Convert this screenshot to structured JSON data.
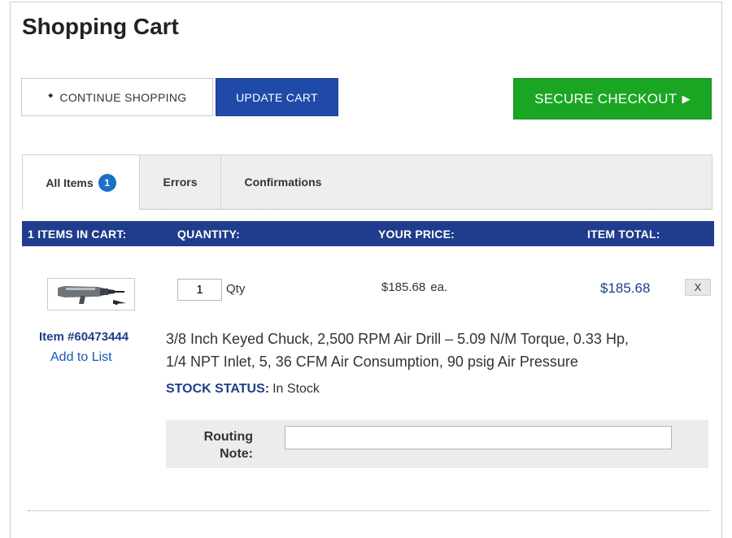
{
  "page": {
    "title": "Shopping Cart"
  },
  "actions": {
    "continue_label": "CONTINUE SHOPPING",
    "update_label": "UPDATE CART",
    "checkout_label": "SECURE CHECKOUT"
  },
  "tabs": [
    {
      "label": "All Items",
      "badge": "1",
      "active": true
    },
    {
      "label": "Errors"
    },
    {
      "label": "Confirmations"
    }
  ],
  "table_header": {
    "items": "1 ITEMS IN CART:",
    "quantity": "QUANTITY:",
    "price": "YOUR PRICE:",
    "total": "ITEM TOTAL:"
  },
  "item": {
    "number": "Item #60473444",
    "add_to_list": "Add to List",
    "quantity": "1",
    "qty_label": "Qty",
    "price": "$185.68",
    "price_unit": "ea.",
    "total": "$185.68",
    "remove_label": "X",
    "description_line1": "3/8 Inch Keyed Chuck, 2,500 RPM Air Drill – 5.09 N/M Torque, 0.33 Hp,",
    "description_line2": "1/4 NPT Inlet, 5, 36 CFM Air Consumption, 90 psig Air Pressure",
    "stock_label": "STOCK STATUS:",
    "stock_value": "In Stock",
    "routing_label_line1": "Routing",
    "routing_label_line2": "Note:",
    "routing_value": ""
  },
  "colors": {
    "header_blue": "#1f3d8c",
    "update_blue": "#1f4aa8",
    "checkout_green": "#1aa623",
    "badge_blue": "#1a6fc7"
  },
  "icons": {
    "back": "arrow-left-icon",
    "forward": "triangle-right-icon",
    "product": "air-drill-image"
  }
}
